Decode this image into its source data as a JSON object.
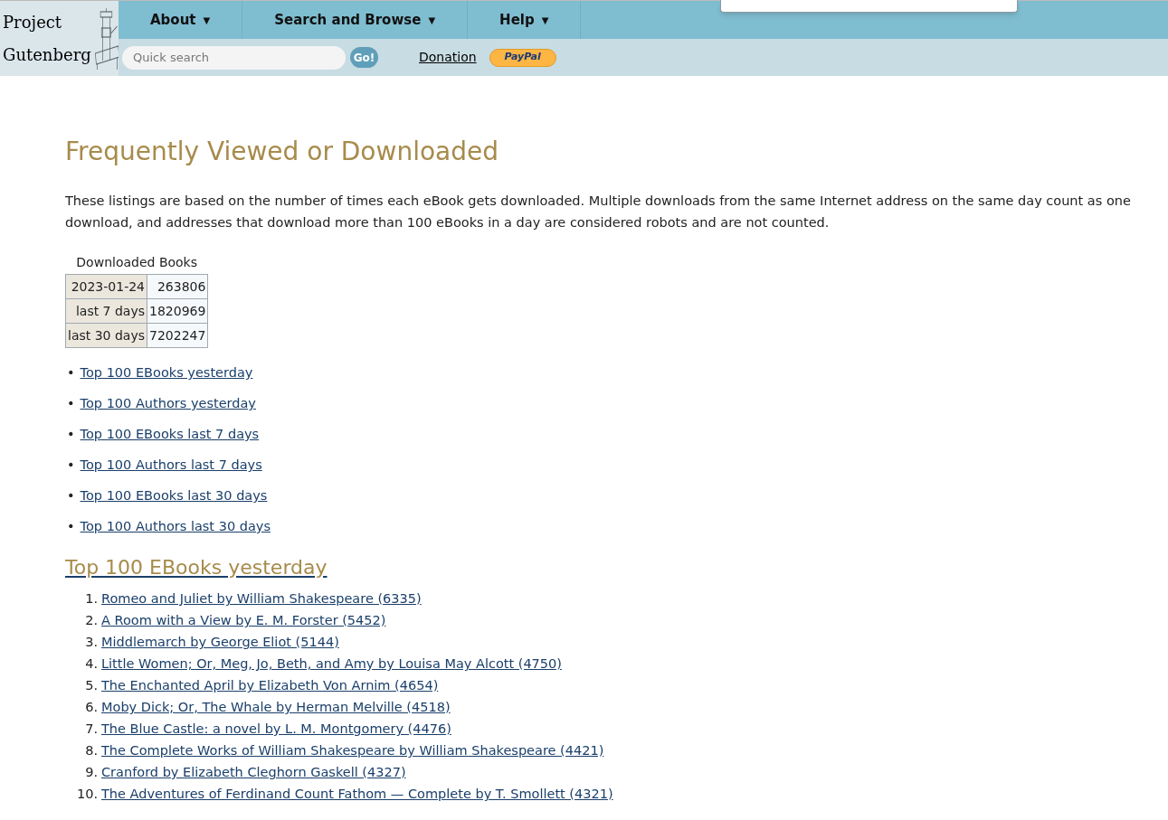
{
  "logo": {
    "line_1": "Project",
    "line_2": "Gutenberg"
  },
  "menu": [
    {
      "label": "About",
      "caret": "▼"
    },
    {
      "label": "Search and Browse",
      "caret": "▼"
    },
    {
      "label": "Help",
      "caret": "▼"
    }
  ],
  "search": {
    "placeholder": "Quick search",
    "button": "Go!"
  },
  "donation": {
    "link": "Donation",
    "paypal": "PayPal"
  },
  "heading": "Frequently Viewed or Downloaded",
  "intro": "These listings are based on the number of times each eBook gets downloaded. Multiple downloads from the same Internet address on the same day count as one download, and addresses that download more than 100 eBooks in a day are considered robots and are not counted.",
  "stats": {
    "caption": "Downloaded Books",
    "rows": [
      {
        "label": "2023-01-24",
        "value": "263806"
      },
      {
        "label": "last 7 days",
        "value": "1820969"
      },
      {
        "label": "last 30 days",
        "value": "7202247"
      }
    ]
  },
  "links": [
    {
      "bullet": "•",
      "label": "Top 100 EBooks yesterday"
    },
    {
      "bullet": "•",
      "label": "Top 100 Authors yesterday"
    },
    {
      "bullet": "•",
      "label": "Top 100 EBooks last 7 days"
    },
    {
      "bullet": "•",
      "label": "Top 100 Authors last 7 days"
    },
    {
      "bullet": "•",
      "label": "Top 100 EBooks last 30 days"
    },
    {
      "bullet": "•",
      "label": "Top 100 Authors last 30 days"
    }
  ],
  "section_title": "Top 100 EBooks yesterday",
  "books": [
    {
      "number": "1.",
      "label": "Romeo and Juliet by William Shakespeare (6335)"
    },
    {
      "number": "2.",
      "label": "A Room with a View by E. M. Forster (5452)"
    },
    {
      "number": "3.",
      "label": "Middlemarch by George Eliot (5144)"
    },
    {
      "number": "4.",
      "label": "Little Women; Or, Meg, Jo, Beth, and Amy by Louisa May Alcott (4750)"
    },
    {
      "number": "5.",
      "label": "The Enchanted April by Elizabeth Von Arnim (4654)"
    },
    {
      "number": "6.",
      "label": "Moby Dick; Or, The Whale by Herman Melville (4518)"
    },
    {
      "number": "7.",
      "label": "The Blue Castle: a novel by L. M. Montgomery (4476)"
    },
    {
      "number": "8.",
      "label": "The Complete Works of William Shakespeare by William Shakespeare (4421)"
    },
    {
      "number": "9.",
      "label": "Cranford by Elizabeth Cleghorn Gaskell (4327)"
    },
    {
      "number": "10.",
      "label": "The Adventures of Ferdinand Count Fathom — Complete by T. Smollett (4321)"
    }
  ]
}
